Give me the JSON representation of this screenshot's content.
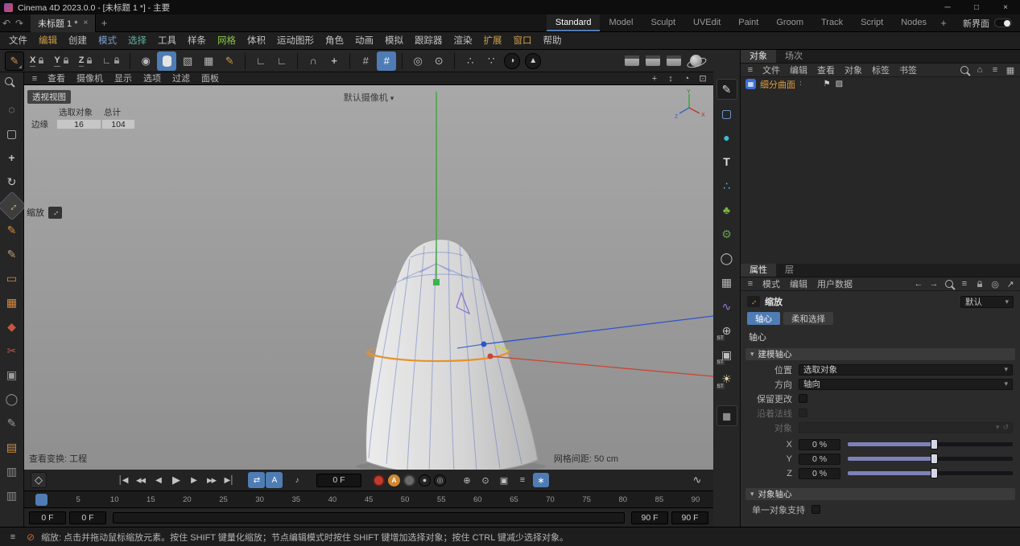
{
  "glyphs": {
    "minimize": "─",
    "maximize": "□",
    "close": "×",
    "undo": "↶",
    "redo": "↷",
    "plus": "+",
    "tab_close": "×",
    "hamburger": "≡",
    "dropdown": "▾",
    "section": "▾",
    "pencil": "✎",
    "circle_dot": "◉",
    "cube_a": "▧",
    "cube_b": "▦",
    "angle": "∟",
    "magnet": "∩",
    "snap_plus": "+",
    "grid": "#",
    "ring": "◎",
    "dot_ring": "⊙",
    "nodes_a": "∴",
    "nodes_b": "∵",
    "half_circle": "◑",
    "triangle": "▲",
    "vp_pan": "+",
    "vp_dolly": "↕",
    "vp_orbit": "◔",
    "vp_max": "⊡",
    "scale_diag": "↔",
    "home": "⌂",
    "panel": "▦",
    "back": "←",
    "forward": "→",
    "popout": "↗",
    "flag": "⚑",
    "checker": "▨",
    "vdots": "∶",
    "link_dd": "▾",
    "link_reset": "↺",
    "key_diamond": "◇",
    "rec_a": "A",
    "dark_sphere": "●",
    "dark_ring": "◎",
    "curve": "∿",
    "prohibit": "⊘"
  },
  "colors": {
    "accent_blue": "#4f7cb4",
    "selection_orange": "#e8922a",
    "object_orange": "#e09c3f"
  },
  "titlebar": {
    "title": "Cinema 4D 2023.0.0 - [未标题 1 *] - 主要"
  },
  "tabrow": {
    "document_tab": "未标题 1 *",
    "new_ui_label": "新界面",
    "layout_tabs": [
      {
        "label": "Standard",
        "cls": "active"
      },
      {
        "label": "Model"
      },
      {
        "label": "Sculpt"
      },
      {
        "label": "UVEdit"
      },
      {
        "label": "Paint"
      },
      {
        "label": "Groom"
      },
      {
        "label": "Track"
      },
      {
        "label": "Script"
      },
      {
        "label": "Nodes"
      }
    ]
  },
  "menubar": {
    "items": [
      {
        "label": "文件"
      },
      {
        "label": "编辑",
        "color": "#cfa04a"
      },
      {
        "label": "创建"
      },
      {
        "label": "模式",
        "color": "#7f9fce"
      },
      {
        "label": "选择",
        "color": "#5fb3a1"
      },
      {
        "label": "工具"
      },
      {
        "label": "样条"
      },
      {
        "label": "网格",
        "color": "#8bc34a"
      },
      {
        "label": "体积"
      },
      {
        "label": "运动图形"
      },
      {
        "label": "角色"
      },
      {
        "label": "动画"
      },
      {
        "label": "模拟"
      },
      {
        "label": "跟踪器"
      },
      {
        "label": "渲染"
      },
      {
        "label": "扩展",
        "color": "#cfa04a"
      },
      {
        "label": "窗口",
        "color": "#cfa04a"
      },
      {
        "label": "帮助"
      }
    ]
  },
  "toolbar": {
    "axis_x": "X",
    "axis_y": "Y",
    "axis_z": "Z"
  },
  "left_toolbar": {
    "tools": [
      {
        "name": "zoom-tool-icon",
        "glyph": "",
        "color": "#b8b8b8",
        "cls": "i-mag"
      },
      {
        "name": "live-selection-icon",
        "glyph": "◌",
        "color": "#c4c4c4"
      },
      {
        "name": "rect-selection-icon",
        "glyph": "▢",
        "color": "#c4c4c4"
      },
      {
        "name": "move-tool-icon",
        "glyph": "+",
        "color": "#c4c4c4",
        "cls": "bold"
      },
      {
        "name": "rotate-tool-icon",
        "glyph": "↻",
        "color": "#c4c4c4"
      },
      {
        "name": "scale-tool-icon",
        "glyph": "↔",
        "color": "#e0a060",
        "cls": "rot45 activetool"
      },
      {
        "name": "polygon-pen-icon",
        "glyph": "✎",
        "color": "#d98c3f"
      },
      {
        "name": "sketch-pen-icon",
        "glyph": "✎",
        "color": "#b99a7a"
      },
      {
        "name": "tweak-tool-icon",
        "glyph": "▭",
        "color": "#d98c3f"
      },
      {
        "name": "box-modeling-icon",
        "glyph": "▦",
        "color": "#d98c3f"
      },
      {
        "name": "polygon-object-icon",
        "glyph": "◆",
        "color": "#c25742"
      },
      {
        "name": "knife-tool-icon",
        "glyph": "✂",
        "color": "#c25742"
      },
      {
        "name": "anchor-tool-icon",
        "glyph": "▣",
        "color": "#9a9a9a"
      },
      {
        "name": "cylinder-tool-icon",
        "glyph": "◯",
        "color": "#9a9a9a"
      },
      {
        "name": "pen-tool-icon",
        "glyph": "✎",
        "color": "#9a9a9a"
      },
      {
        "name": "array-tool-icon",
        "glyph": "▤",
        "color": "#d98c3f"
      },
      {
        "name": "floor-object-icon",
        "glyph": "▥",
        "color": "#8a8a8a"
      },
      {
        "name": "stage-object-icon",
        "glyph": "▥",
        "color": "#8a8a8a"
      }
    ]
  },
  "viewport": {
    "menus": [
      "查看",
      "摄像机",
      "显示",
      "选项",
      "过滤",
      "面板"
    ],
    "view_label": "透视视图",
    "camera_label": "默认摄像机",
    "selection": {
      "col_selected": "选取对象",
      "col_total": "总计",
      "row_label": "边缘",
      "selected": "16",
      "total": "104"
    },
    "tool_hud": "缩放",
    "transform_hud": "查看变换: 工程",
    "grid_hud": "网格间距: 50 cm",
    "axis": {
      "x": "X",
      "y": "Y",
      "z": "Z"
    }
  },
  "right_strip": {
    "items": [
      {
        "name": "spline-pen-icon",
        "glyph": "✎",
        "color": "#d8d8d8",
        "cls": "boxed"
      },
      {
        "name": "cube-primitive-icon",
        "glyph": "▢",
        "color": "#7fb2e8"
      },
      {
        "name": "sphere-primitive-icon",
        "glyph": "●",
        "color": "#38c0d8"
      },
      {
        "name": "text-primitive-icon",
        "glyph": "T",
        "color": "#e0e0e0",
        "cls": "bold"
      },
      {
        "name": "mograph-cloner-icon",
        "glyph": "∴",
        "color": "#58b5e0"
      },
      {
        "name": "field-object-icon",
        "glyph": "♣",
        "color": "#7cb342"
      },
      {
        "name": "volume-builder-icon",
        "glyph": "⚙",
        "color": "#6a9a55"
      },
      {
        "name": "spline-circle-icon",
        "glyph": "◯",
        "color": "#c8c8c8"
      },
      {
        "name": "scene-manager-icon",
        "glyph": "▦",
        "color": "#b8b8b8"
      },
      {
        "name": "deformer-icon",
        "glyph": "∿",
        "color": "#9b7fd4"
      },
      {
        "name": "sky-object-icon",
        "glyph": "⊕",
        "color": "#bdbdbd",
        "badge": "ST"
      },
      {
        "name": "camera-object-icon",
        "glyph": "▣",
        "color": "#bdbdbd",
        "badge": "ST"
      },
      {
        "name": "light-object-icon",
        "glyph": "☀",
        "color": "#e0d7a8",
        "badge": "ST"
      },
      {
        "name": "material-icon",
        "glyph": "◼",
        "color": "#8a8a8a",
        "cls": "boxed gap-top"
      }
    ]
  },
  "object_manager": {
    "tabs": [
      "对象",
      "场次"
    ],
    "menus": [
      "文件",
      "编辑",
      "查看",
      "对象",
      "标签",
      "书签"
    ],
    "objects": [
      {
        "name": "细分曲面"
      }
    ]
  },
  "attributes": {
    "tabs": [
      "属性",
      "层"
    ],
    "menus": [
      "模式",
      "编辑",
      "用户数据"
    ],
    "tool_title": "缩放",
    "preset_value": "默认",
    "mode_axis": "轴心",
    "mode_soft": "柔和选择",
    "group_label": "轴心",
    "section_modeling": "建模轴心",
    "section_object": "对象轴心",
    "rows": {
      "position_label": "位置",
      "position_value": "选取对象",
      "orientation_label": "方向",
      "orientation_value": "轴向",
      "keep_label": "保留更改",
      "normals_label": "沿着法线",
      "object_label": "对象",
      "x_label": "X",
      "x_value": "0 %",
      "y_label": "Y",
      "y_value": "0 %",
      "z_label": "Z",
      "z_value": "0 %"
    },
    "single_object_label": "单一对象支持"
  },
  "timeline": {
    "current_frame": "0 F",
    "ticks": [
      "0",
      "5",
      "10",
      "15",
      "20",
      "25",
      "30",
      "35",
      "40",
      "45",
      "50",
      "55",
      "60",
      "65",
      "70",
      "75",
      "80",
      "85",
      "90"
    ],
    "range_start_a": "0 F",
    "range_start_b": "0 F",
    "range_end_a": "90 F",
    "range_end_b": "90 F",
    "transport": [
      {
        "name": "go-to-start-button",
        "glyph": "│◀"
      },
      {
        "name": "previous-key-button",
        "glyph": "◀◀",
        "cls": "sm"
      },
      {
        "name": "previous-frame-button",
        "glyph": "◀"
      },
      {
        "name": "play-button",
        "glyph": "▶",
        "cls": "big"
      },
      {
        "name": "next-frame-button",
        "glyph": "▶"
      },
      {
        "name": "next-key-button",
        "glyph": "▶▶",
        "cls": "sm"
      },
      {
        "name": "go-to-end-button",
        "glyph": "▶│"
      },
      {
        "name": "loop-mode-button",
        "glyph": "⇄",
        "cls": "on gap"
      },
      {
        "name": "autokey-a-button",
        "glyph": "A",
        "cls": "on"
      },
      {
        "name": "sound-button",
        "glyph": "♪",
        "cls": "gap-sm"
      }
    ],
    "key_toggles": [
      {
        "name": "record-position-button",
        "glyph": "⊕"
      },
      {
        "name": "record-rotation-button",
        "glyph": "⊙"
      },
      {
        "name": "record-scale-button",
        "glyph": "▣"
      },
      {
        "name": "record-parameter-button",
        "glyph": "≡"
      },
      {
        "name": "record-pla-button",
        "glyph": "∗",
        "cls": "on"
      }
    ]
  },
  "statusbar": {
    "message": "缩放: 点击并拖动鼠标缩放元素。按住 SHIFT 键量化缩放；节点编辑模式时按住 SHIFT 键增加选择对象；按住 CTRL 键减少选择对象。"
  }
}
